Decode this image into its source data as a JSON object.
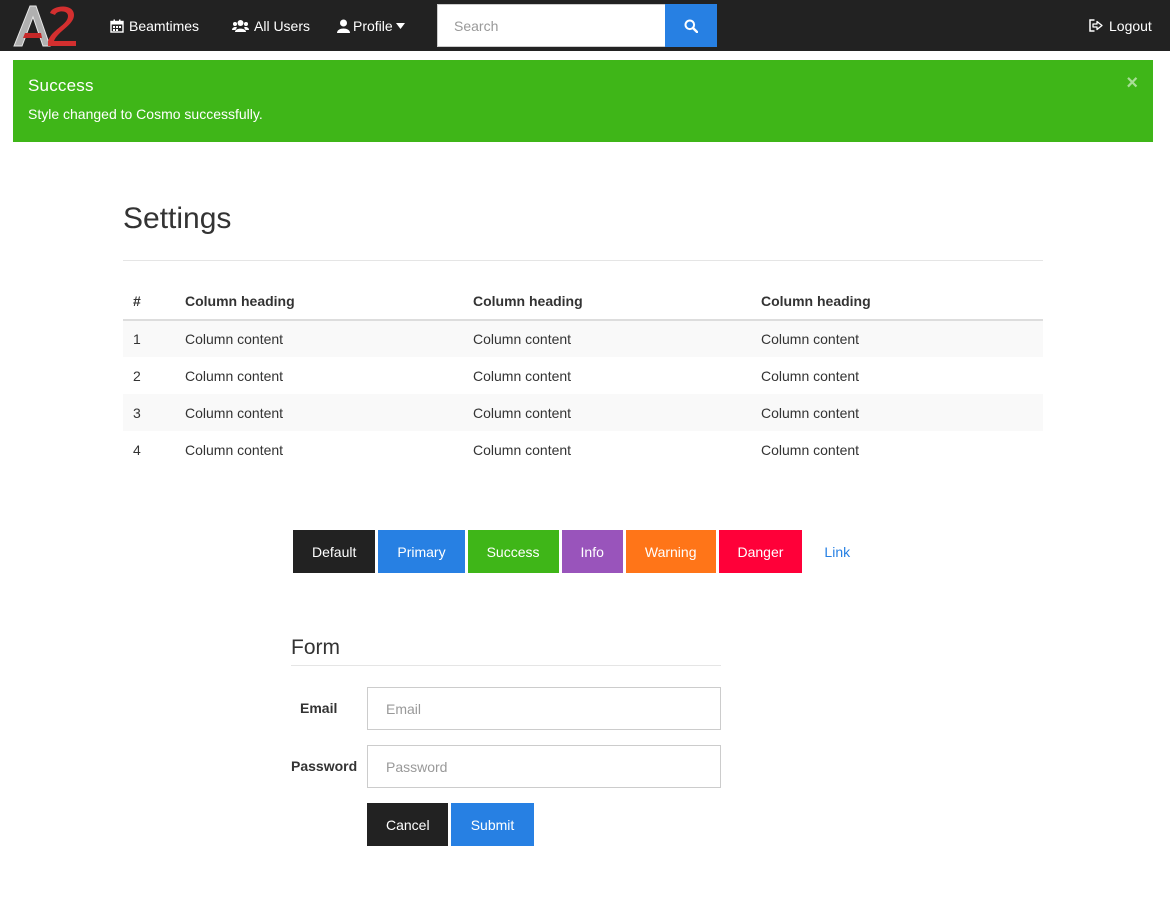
{
  "navbar": {
    "brand_text": "A2",
    "items": [
      {
        "label": "Beamtimes",
        "icon": "calendar-icon"
      },
      {
        "label": "All Users",
        "icon": "users-icon"
      },
      {
        "label": "Profile",
        "icon": "user-icon"
      }
    ],
    "search_placeholder": "Search",
    "logout_label": "Logout"
  },
  "alert": {
    "title": "Success",
    "message": "Style changed to Cosmo successfully.",
    "close": "×"
  },
  "page": {
    "title": "Settings"
  },
  "table": {
    "headers": [
      "#",
      "Column heading",
      "Column heading",
      "Column heading"
    ],
    "rows": [
      [
        "1",
        "Column content",
        "Column content",
        "Column content"
      ],
      [
        "2",
        "Column content",
        "Column content",
        "Column content"
      ],
      [
        "3",
        "Column content",
        "Column content",
        "Column content"
      ],
      [
        "4",
        "Column content",
        "Column content",
        "Column content"
      ]
    ]
  },
  "buttons": {
    "default": "Default",
    "primary": "Primary",
    "success": "Success",
    "info": "Info",
    "warning": "Warning",
    "danger": "Danger",
    "link": "Link"
  },
  "form": {
    "legend": "Form",
    "email_label": "Email",
    "email_placeholder": "Email",
    "password_label": "Password",
    "password_placeholder": "Password",
    "cancel_label": "Cancel",
    "submit_label": "Submit"
  },
  "colors": {
    "navbar_bg": "#222222",
    "primary": "#2780e3",
    "success": "#3fb618",
    "info": "#9954bb",
    "warning": "#ff7518",
    "danger": "#ff0039"
  }
}
